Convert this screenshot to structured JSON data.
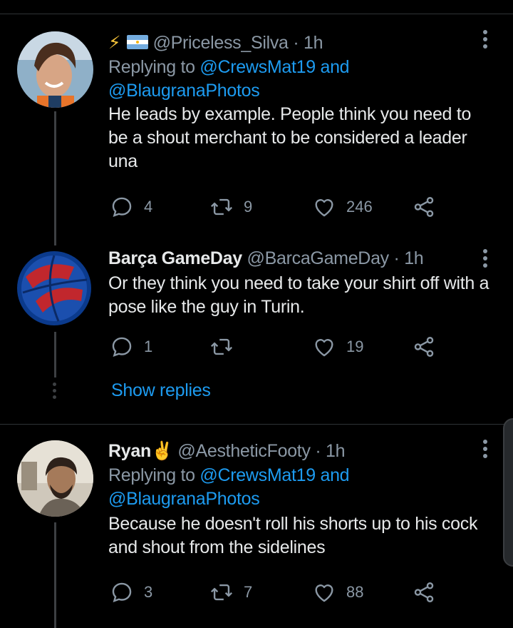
{
  "tweets": [
    {
      "emoji": "⚡",
      "handle": "@Priceless_Silva",
      "time": "1h",
      "replying_prefix": "Replying to ",
      "replying_user1": "@CrewsMat19",
      "replying_and": " and",
      "replying_user2": "@BlaugranaPhotos",
      "text": "He leads by example. People think you need to be a shout merchant to be considered a leader una",
      "replies": "4",
      "retweets": "9",
      "likes": "246"
    },
    {
      "name": "Barça GameDay",
      "handle": "@BarcaGameDay",
      "time": "1h",
      "text": "Or they think you need to take your shirt off with a pose like the guy in Turin.",
      "replies": "1",
      "retweets": "",
      "likes": "19"
    },
    {
      "name": "Ryan",
      "emoji": "✌️",
      "handle": "@AestheticFooty",
      "time": "1h",
      "replying_prefix": "Replying to ",
      "replying_user1": "@CrewsMat19",
      "replying_and": " and",
      "replying_user2": "@BlaugranaPhotos",
      "text": "Because he doesn't roll his shorts up to his cock and shout from the sidelines",
      "replies": "3",
      "retweets": "7",
      "likes": "88"
    }
  ],
  "show_replies": "Show replies",
  "dot_separator": " · ",
  "colors": {
    "link": "#1d9bf0",
    "muted": "#8b98a5",
    "text": "#e7e9ea",
    "background": "#000000"
  }
}
